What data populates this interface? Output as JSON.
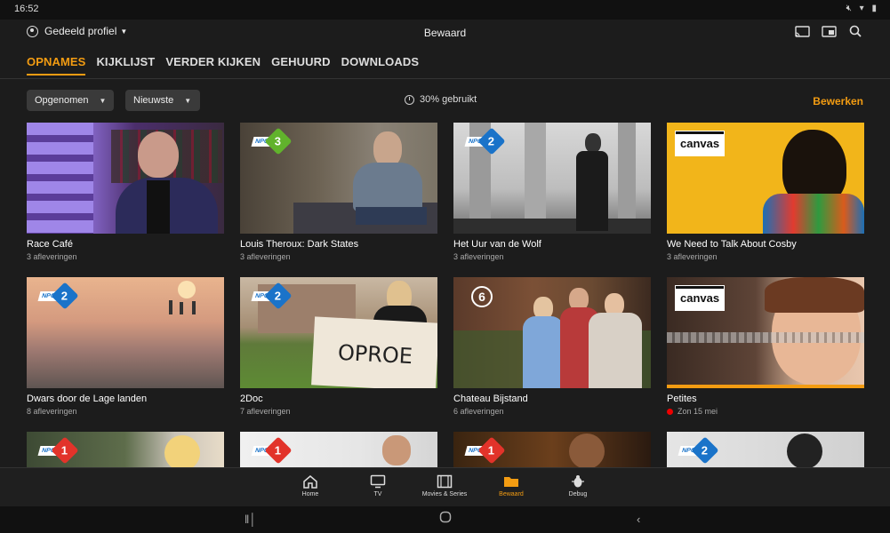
{
  "status": {
    "time": "16:52"
  },
  "header": {
    "profile_label": "Gedeeld profiel",
    "title": "Bewaard",
    "icons": [
      "cast-icon",
      "tv-remote-icon",
      "search-icon"
    ]
  },
  "tabs": [
    {
      "label": "OPNAMES",
      "active": true
    },
    {
      "label": "KIJKLIJST"
    },
    {
      "label": "VERDER KIJKEN"
    },
    {
      "label": "GEHUURD"
    },
    {
      "label": "DOWNLOADS"
    }
  ],
  "filters": {
    "sort_by": "Opgenomen",
    "order": "Nieuwste"
  },
  "usage": "30% gebruikt",
  "edit_label": "Bewerken",
  "cards": [
    {
      "title": "Race Café",
      "subtitle": "3 afleveringen",
      "channel": "none"
    },
    {
      "title": "Louis Theroux: Dark States",
      "subtitle": "3 afleveringen",
      "channel": "NPO 3"
    },
    {
      "title": "Het Uur van de Wolf",
      "subtitle": "3 afleveringen",
      "channel": "NPO 2"
    },
    {
      "title": "We Need to Talk About Cosby",
      "subtitle": "3 afleveringen",
      "channel": "canvas"
    },
    {
      "title": "Dwars door de Lage landen",
      "subtitle": "8 afleveringen",
      "channel": "NPO 2"
    },
    {
      "title": "2Doc",
      "subtitle": "7 afleveringen",
      "channel": "NPO 2"
    },
    {
      "title": "Chateau Bijstand",
      "subtitle": "6 afleveringen",
      "channel": "RTL 6"
    },
    {
      "title": "Petites",
      "subtitle": "Zon 15 mei",
      "channel": "canvas"
    },
    {
      "channel": "NPO 1"
    },
    {
      "channel": "NPO 1"
    },
    {
      "channel": "NPO 1"
    },
    {
      "channel": "NPO 2"
    }
  ],
  "thumb_texts": {
    "canvas": "canvas",
    "npo": "NPO",
    "one": "1",
    "two": "2",
    "three": "3",
    "six": "6",
    "oproep": "OPROE"
  },
  "bottom_nav": [
    {
      "label": "Home",
      "icon": "home-icon"
    },
    {
      "label": "TV",
      "icon": "tv-icon"
    },
    {
      "label": "Movies & Series",
      "icon": "film-icon"
    },
    {
      "label": "Bewaard",
      "icon": "folder-icon",
      "active": true
    },
    {
      "label": "Debug",
      "icon": "bug-icon"
    }
  ],
  "colors": {
    "accent": "#f39c12",
    "background": "#1c1c1c"
  }
}
